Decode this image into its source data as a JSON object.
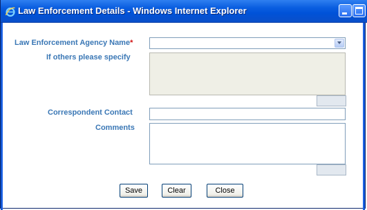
{
  "window": {
    "title": "Law Enforcement Details - Windows Internet Explorer",
    "icon": "ie-logo-icon"
  },
  "form": {
    "agency": {
      "label": "Law Enforcement Agency Name",
      "required_marker": "*",
      "selected_value": ""
    },
    "others": {
      "label": "If others please specify",
      "value": ""
    },
    "correspondent": {
      "label": "Correspondent Contact",
      "value": ""
    },
    "comments": {
      "label": "Comments",
      "value": ""
    }
  },
  "buttons": {
    "save": "Save",
    "clear": "Clear",
    "close": "Close"
  },
  "colors": {
    "label": "#3a77b5",
    "required": "#d01010",
    "titlebar": "#0a5ee0"
  }
}
